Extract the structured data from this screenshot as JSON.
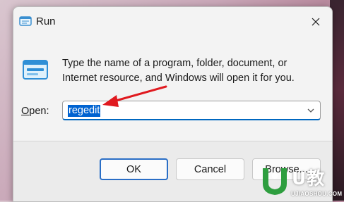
{
  "window": {
    "title": "Run",
    "close_glyph": "✕"
  },
  "description": {
    "line1": "Type the name of a program, folder, document, or",
    "line2": "Internet resource, and Windows will open it for you."
  },
  "open_field": {
    "label_accel": "O",
    "label_rest": "pen:",
    "value": "regedit"
  },
  "buttons": {
    "ok": "OK",
    "cancel": "Cancel",
    "browse": "Browse..."
  },
  "watermark": {
    "brand": "U教",
    "url": "UJIAOSHOU.COM"
  },
  "colors": {
    "accent": "#0067c0",
    "selection": "#0063d1",
    "annotation_arrow": "#e0191f",
    "watermark_green": "#2e9e3f"
  },
  "icons": {
    "title": "run-app-icon",
    "description": "run-app-icon",
    "dropdown": "chevron-down-icon",
    "close": "close-icon",
    "annotation": "red-arrow-annotation"
  }
}
